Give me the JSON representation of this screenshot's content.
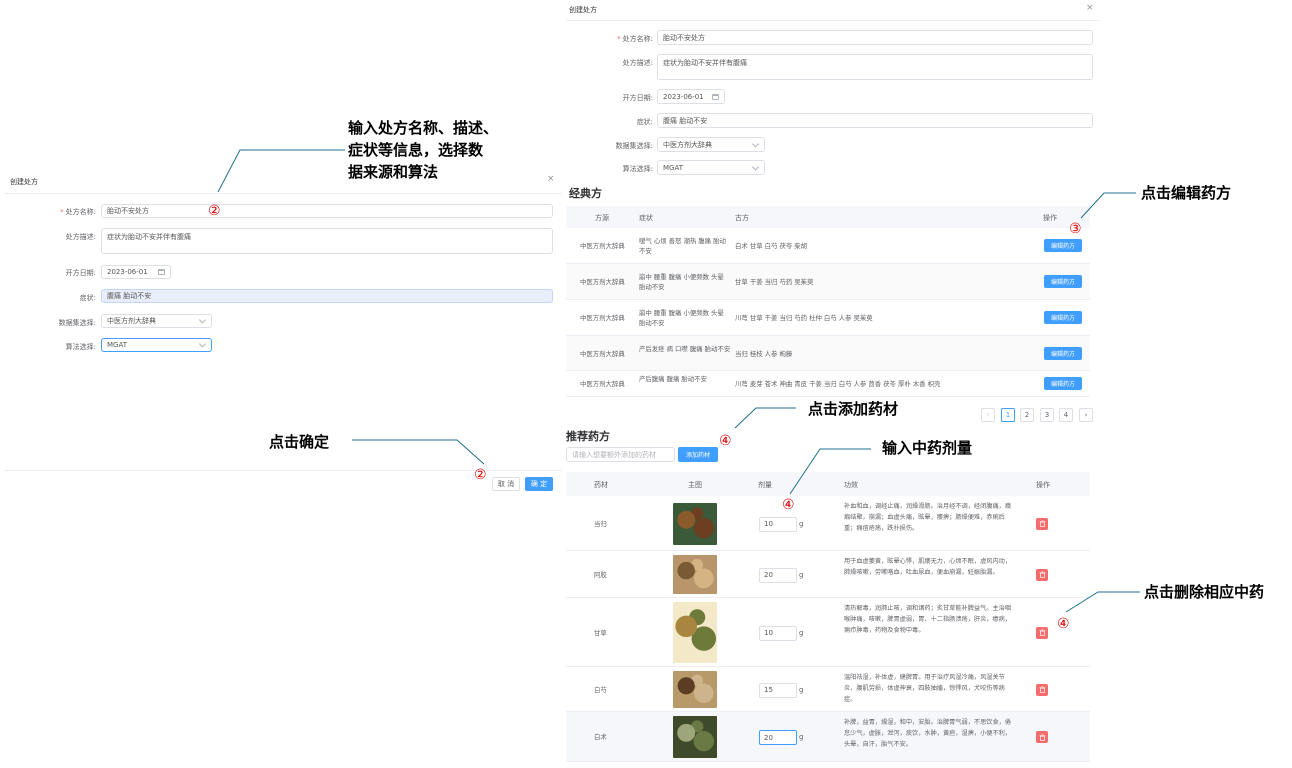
{
  "left_dialog": {
    "title": "创建处方",
    "close": "×",
    "name_label": "处方名称:",
    "name_value": "胎动不安处方",
    "desc_label": "处方描述:",
    "desc_value": "症状为胎动不安并伴有腹痛",
    "date_label": "开方日期:",
    "date_value": "2023-06-01",
    "symptom_label": "症状:",
    "symptom_value": "腹痛 胎动不安",
    "dataset_label": "数据集选择:",
    "dataset_value": "中医方剂大辞典",
    "algo_label": "算法选择:",
    "algo_value": "MGAT",
    "cancel": "取 消",
    "confirm": "确 定"
  },
  "right_dialog": {
    "title": "创建处方",
    "close": "×",
    "name_label": "处方名称:",
    "name_value": "胎动不安处方",
    "desc_label": "处方描述:",
    "desc_value": "症状为胎动不安并伴有腹痛",
    "date_label": "开方日期:",
    "date_value": "2023-06-01",
    "symptom_label": "症状:",
    "symptom_value": "腹痛 胎动不安",
    "dataset_label": "数据集选择:",
    "dataset_value": "中医方剂大辞典",
    "algo_label": "算法选择:",
    "algo_value": "MGAT"
  },
  "classic": {
    "heading": "经典方",
    "headers": {
      "source": "方源",
      "symptom": "症状",
      "formula": "古方",
      "op": "操作"
    },
    "rows": [
      {
        "source": "中医方剂大辞典",
        "symptom": "嗳气 心烦 善怒 潮热 腹痛 胎动不安",
        "formula": "白术 甘草 白芍 茯苓 柴胡",
        "btn": "编辑药方"
      },
      {
        "source": "中医方剂大辞典",
        "symptom": "崩中 腰重 腹痛 小便频数 头晕 胎动不安",
        "formula": "甘草 干姜 当归 芍药 吴茱萸",
        "btn": "编辑药方"
      },
      {
        "source": "中医方剂大辞典",
        "symptom": "崩中 腰重 腹痛 小便频数 头晕 胎动不安",
        "formula": "川芎 甘草 干姜 当归 芍药 杜仲 白芍 人参 吴茱萸",
        "btn": "编辑药方"
      },
      {
        "source": "中医方剂大辞典",
        "symptom": "产后发痉 病 口噤 腹痛 胎动不安",
        "formula": "当归 桂枝 人参 枸藤",
        "btn": "编辑药方"
      },
      {
        "source": "中医方剂大辞典",
        "symptom": "产后腹痛 腹痛 胎动不安",
        "formula": "川芎 麦芽 苍术 神曲 青皮 干姜 当归 白芍 人参 茴香 茯苓 厚朴 木香 枳壳",
        "btn": "编辑药方"
      }
    ],
    "pagination": {
      "prev": "‹",
      "pages": [
        "1",
        "2",
        "3",
        "4"
      ],
      "next": "›"
    }
  },
  "recommend": {
    "heading": "推荐药方",
    "search_placeholder": "请输入想要额外添加的药材",
    "add_btn": "添加药材",
    "headers": {
      "herb": "药材",
      "image": "主图",
      "dose": "剂量",
      "effect": "功效",
      "op": "操作"
    },
    "unit": "g",
    "rows": [
      {
        "herb": "当归",
        "dose": "10",
        "effect": "补血和血，调经止痛，润燥滑肠。治月经不调，经闭腹痛，癥瘕结聚，崩漏；血虚头痛，眩晕，痿痹；肠燥便难，赤痢后重；痈疽疮疡，跌扑损伤。"
      },
      {
        "herb": "阿胶",
        "dose": "20",
        "effect": "用于血虚萎黄，眩晕心悸，肌痿无力，心烦不眠，虚风内动，肺燥咳嗽，劳嗽咯血，吐血尿血，便血崩漏，妊娠胎漏。"
      },
      {
        "herb": "甘草",
        "dose": "10",
        "effect": "清热解毒，润肺止咳，调和诸药；炙甘草能补脾益气。主治咽喉肿痛，咳嗽，脾胃虚弱，胃、十二指肠溃疡，肝炎，癔病，痈疖肿毒，药物及食物中毒。"
      },
      {
        "herb": "白芍",
        "dose": "15",
        "effect": "温阳祛湿，补体虚，健脾胃。用于治疗风湿冷痛，风湿关节炎，腰肌劳损，体虚神衰，四肢抽搐，惊悸风，犬咬伤等病症。"
      },
      {
        "herb": "白术",
        "dose": "20",
        "effect": "补脾，益胃，燥湿，和中，安胎。治脾胃气弱，不思饮食，倦怠少气，虚胀，泄泻，痰饮，水肿，黄疸，湿痹，小便不利，头晕，自汗，胎气不安。"
      }
    ]
  },
  "annotations": {
    "a1_line1": "输入处方名称、描述、",
    "a1_line2": "症状等信息，选择数",
    "a1_line3": "据来源和算法",
    "a2": "点击编辑药方",
    "a3": "点击确定",
    "a4": "点击添加药材",
    "a5": "输入中药剂量",
    "a6": "点击删除相应中药",
    "n2a": "②",
    "n2b": "②",
    "n3": "③",
    "n4a": "④",
    "n4b": "④",
    "n4c": "④"
  },
  "colors": {
    "primary": "#409eff",
    "danger": "#f56c6c",
    "annotation": "#e00000"
  }
}
